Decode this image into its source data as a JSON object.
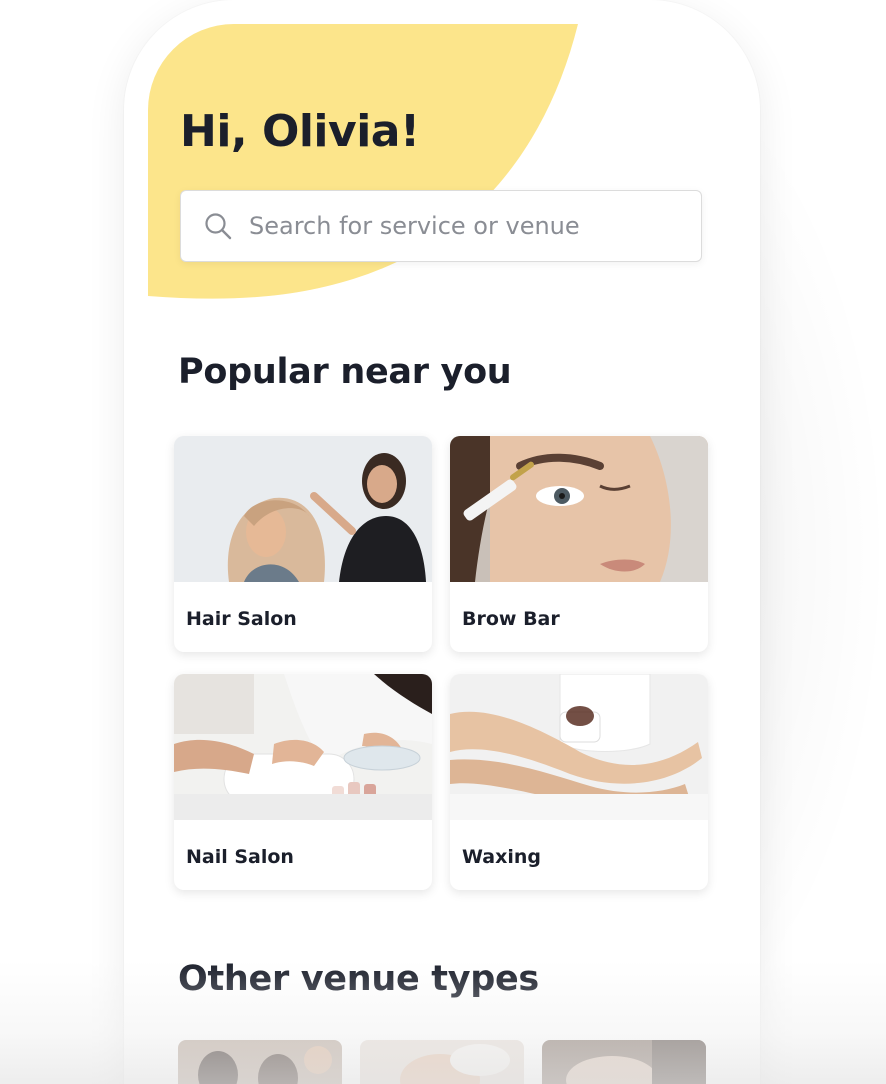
{
  "header": {
    "greeting": "Hi, Olivia!",
    "accent_color": "#fce58b"
  },
  "search": {
    "placeholder": "Search for service or venue",
    "icon": "search-icon"
  },
  "popular": {
    "title": "Popular near you",
    "cards": [
      {
        "label": "Hair Salon"
      },
      {
        "label": "Brow Bar"
      },
      {
        "label": "Nail Salon"
      },
      {
        "label": "Waxing"
      }
    ]
  },
  "other_venues": {
    "title": "Other venue types"
  }
}
